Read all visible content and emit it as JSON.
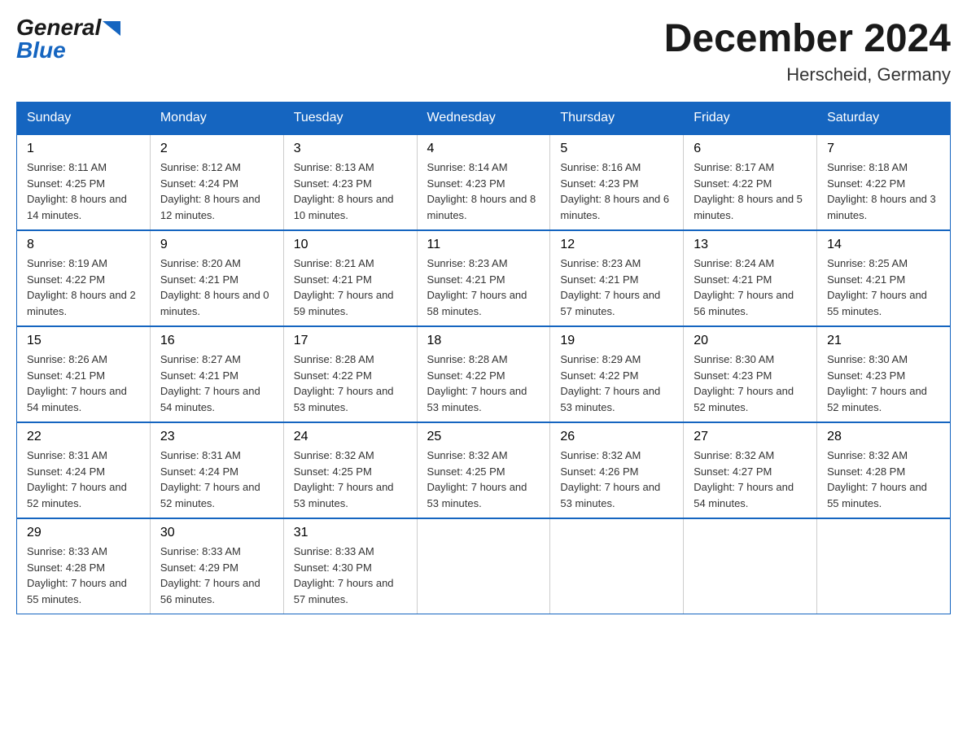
{
  "logo": {
    "general": "General",
    "blue": "Blue",
    "arrow": "▶"
  },
  "title": {
    "month_year": "December 2024",
    "location": "Herscheid, Germany"
  },
  "days_of_week": [
    "Sunday",
    "Monday",
    "Tuesday",
    "Wednesday",
    "Thursday",
    "Friday",
    "Saturday"
  ],
  "weeks": [
    [
      {
        "day": "1",
        "sunrise": "8:11 AM",
        "sunset": "4:25 PM",
        "daylight": "8 hours and 14 minutes."
      },
      {
        "day": "2",
        "sunrise": "8:12 AM",
        "sunset": "4:24 PM",
        "daylight": "8 hours and 12 minutes."
      },
      {
        "day": "3",
        "sunrise": "8:13 AM",
        "sunset": "4:23 PM",
        "daylight": "8 hours and 10 minutes."
      },
      {
        "day": "4",
        "sunrise": "8:14 AM",
        "sunset": "4:23 PM",
        "daylight": "8 hours and 8 minutes."
      },
      {
        "day": "5",
        "sunrise": "8:16 AM",
        "sunset": "4:23 PM",
        "daylight": "8 hours and 6 minutes."
      },
      {
        "day": "6",
        "sunrise": "8:17 AM",
        "sunset": "4:22 PM",
        "daylight": "8 hours and 5 minutes."
      },
      {
        "day": "7",
        "sunrise": "8:18 AM",
        "sunset": "4:22 PM",
        "daylight": "8 hours and 3 minutes."
      }
    ],
    [
      {
        "day": "8",
        "sunrise": "8:19 AM",
        "sunset": "4:22 PM",
        "daylight": "8 hours and 2 minutes."
      },
      {
        "day": "9",
        "sunrise": "8:20 AM",
        "sunset": "4:21 PM",
        "daylight": "8 hours and 0 minutes."
      },
      {
        "day": "10",
        "sunrise": "8:21 AM",
        "sunset": "4:21 PM",
        "daylight": "7 hours and 59 minutes."
      },
      {
        "day": "11",
        "sunrise": "8:23 AM",
        "sunset": "4:21 PM",
        "daylight": "7 hours and 58 minutes."
      },
      {
        "day": "12",
        "sunrise": "8:23 AM",
        "sunset": "4:21 PM",
        "daylight": "7 hours and 57 minutes."
      },
      {
        "day": "13",
        "sunrise": "8:24 AM",
        "sunset": "4:21 PM",
        "daylight": "7 hours and 56 minutes."
      },
      {
        "day": "14",
        "sunrise": "8:25 AM",
        "sunset": "4:21 PM",
        "daylight": "7 hours and 55 minutes."
      }
    ],
    [
      {
        "day": "15",
        "sunrise": "8:26 AM",
        "sunset": "4:21 PM",
        "daylight": "7 hours and 54 minutes."
      },
      {
        "day": "16",
        "sunrise": "8:27 AM",
        "sunset": "4:21 PM",
        "daylight": "7 hours and 54 minutes."
      },
      {
        "day": "17",
        "sunrise": "8:28 AM",
        "sunset": "4:22 PM",
        "daylight": "7 hours and 53 minutes."
      },
      {
        "day": "18",
        "sunrise": "8:28 AM",
        "sunset": "4:22 PM",
        "daylight": "7 hours and 53 minutes."
      },
      {
        "day": "19",
        "sunrise": "8:29 AM",
        "sunset": "4:22 PM",
        "daylight": "7 hours and 53 minutes."
      },
      {
        "day": "20",
        "sunrise": "8:30 AM",
        "sunset": "4:23 PM",
        "daylight": "7 hours and 52 minutes."
      },
      {
        "day": "21",
        "sunrise": "8:30 AM",
        "sunset": "4:23 PM",
        "daylight": "7 hours and 52 minutes."
      }
    ],
    [
      {
        "day": "22",
        "sunrise": "8:31 AM",
        "sunset": "4:24 PM",
        "daylight": "7 hours and 52 minutes."
      },
      {
        "day": "23",
        "sunrise": "8:31 AM",
        "sunset": "4:24 PM",
        "daylight": "7 hours and 52 minutes."
      },
      {
        "day": "24",
        "sunrise": "8:32 AM",
        "sunset": "4:25 PM",
        "daylight": "7 hours and 53 minutes."
      },
      {
        "day": "25",
        "sunrise": "8:32 AM",
        "sunset": "4:25 PM",
        "daylight": "7 hours and 53 minutes."
      },
      {
        "day": "26",
        "sunrise": "8:32 AM",
        "sunset": "4:26 PM",
        "daylight": "7 hours and 53 minutes."
      },
      {
        "day": "27",
        "sunrise": "8:32 AM",
        "sunset": "4:27 PM",
        "daylight": "7 hours and 54 minutes."
      },
      {
        "day": "28",
        "sunrise": "8:32 AM",
        "sunset": "4:28 PM",
        "daylight": "7 hours and 55 minutes."
      }
    ],
    [
      {
        "day": "29",
        "sunrise": "8:33 AM",
        "sunset": "4:28 PM",
        "daylight": "7 hours and 55 minutes."
      },
      {
        "day": "30",
        "sunrise": "8:33 AM",
        "sunset": "4:29 PM",
        "daylight": "7 hours and 56 minutes."
      },
      {
        "day": "31",
        "sunrise": "8:33 AM",
        "sunset": "4:30 PM",
        "daylight": "7 hours and 57 minutes."
      },
      null,
      null,
      null,
      null
    ]
  ],
  "labels": {
    "sunrise": "Sunrise:",
    "sunset": "Sunset:",
    "daylight": "Daylight:"
  }
}
